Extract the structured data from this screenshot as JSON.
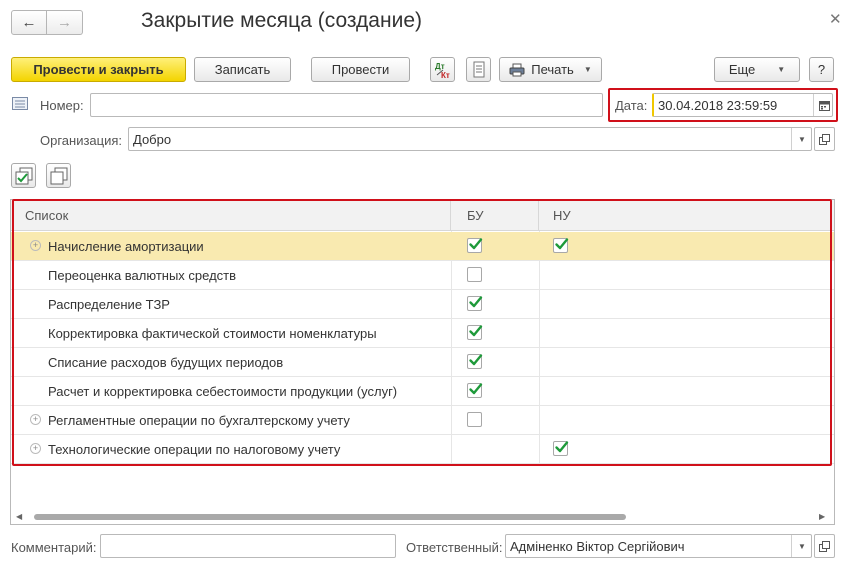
{
  "window": {
    "title": "Закрытие месяца (создание)",
    "back_icon": "arrow-left-icon",
    "forward_icon": "arrow-right-icon",
    "close_icon": "close-icon"
  },
  "toolbar": {
    "post_close_label": "Провести и закрыть",
    "save_label": "Записать",
    "post_label": "Провести",
    "print_label": "Печать",
    "more_label": "Еще",
    "help_label": "?",
    "dtkt_label": "Дт Кт"
  },
  "header": {
    "number_label": "Номер:",
    "number_value": "",
    "date_label": "Дата:",
    "date_value": "30.04.2018 23:59:59",
    "org_label": "Организация:",
    "org_value": "Добро"
  },
  "table": {
    "columns": [
      "Список",
      "БУ",
      "НУ"
    ],
    "rows": [
      {
        "label": "Начисление амортизации",
        "expandable": true,
        "bu": "checked",
        "nu": "checked",
        "selected": true
      },
      {
        "label": "Переоценка валютных средств",
        "expandable": false,
        "bu": "unchecked",
        "nu": "none"
      },
      {
        "label": "Распределение ТЗР",
        "expandable": false,
        "bu": "checked",
        "nu": "none"
      },
      {
        "label": "Корректировка фактической стоимости номенклатуры",
        "expandable": false,
        "bu": "checked",
        "nu": "none"
      },
      {
        "label": "Списание расходов будущих периодов",
        "expandable": false,
        "bu": "checked",
        "nu": "none"
      },
      {
        "label": "Расчет и корректировка себестоимости продукции (услуг)",
        "expandable": false,
        "bu": "checked",
        "nu": "none"
      },
      {
        "label": "Регламентные операции по бухгалтерскому учету",
        "expandable": true,
        "bu": "unchecked",
        "nu": "none"
      },
      {
        "label": "Технологические операции по налоговому учету",
        "expandable": true,
        "bu": "none",
        "nu": "checked"
      }
    ]
  },
  "footer": {
    "comment_label": "Комментарий:",
    "comment_value": "",
    "responsible_label": "Ответственный:",
    "responsible_value": "Адміненко Віктор Сергійович"
  },
  "colors": {
    "primary_button": "#f3d400",
    "highlight_box": "#d0101a",
    "selected_row": "#f9eab0",
    "check": "#1e9a3a"
  }
}
